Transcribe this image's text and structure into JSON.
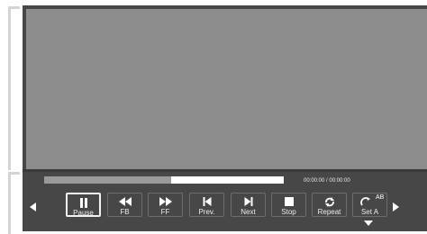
{
  "player": {
    "time_display": "00:00:00 / 00:00:00",
    "progress_fraction": 0.53,
    "controls": [
      {
        "label": "Pause",
        "icon": "pause-icon",
        "active": true
      },
      {
        "label": "FB",
        "icon": "rewind-icon",
        "active": false
      },
      {
        "label": "FF",
        "icon": "fast-forward-icon",
        "active": false
      },
      {
        "label": "Prev.",
        "icon": "previous-icon",
        "active": false
      },
      {
        "label": "Next",
        "icon": "next-icon",
        "active": false
      },
      {
        "label": "Stop",
        "icon": "stop-icon",
        "active": false
      },
      {
        "label": "Repeat",
        "icon": "repeat-icon",
        "active": false
      },
      {
        "label": "Set A",
        "icon": "ab-repeat-icon",
        "active": false,
        "badge": "AB"
      }
    ]
  }
}
